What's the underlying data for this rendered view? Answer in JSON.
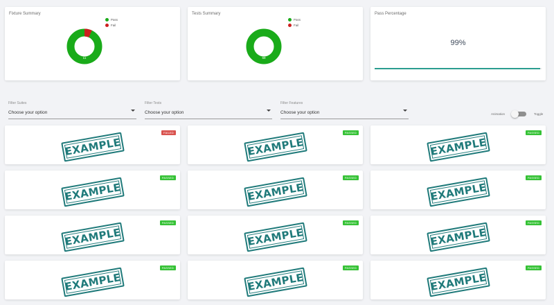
{
  "summary": {
    "fixture": {
      "title": "Fixture Summary",
      "legend": [
        {
          "label": "Pass",
          "color": "#1aab1a"
        },
        {
          "label": "Fail",
          "color": "#cc1f1f"
        }
      ],
      "center_label": "11",
      "pass_fraction": 0.93
    },
    "tests": {
      "title": "Tests Summary",
      "legend": [
        {
          "label": "Pass",
          "color": "#1aab1a"
        },
        {
          "label": "Fail",
          "color": "#cc1f1f"
        }
      ],
      "center_label": "69",
      "pass_fraction": 0.99
    },
    "pass_percentage": {
      "title": "Pass Percentage",
      "value": "99%",
      "bar_fraction": 0.99,
      "bar_color": "#2a9d8f"
    }
  },
  "filters": [
    {
      "label": "Filter Suites",
      "value": "Choose your option"
    },
    {
      "label": "Filter Tests",
      "value": "Choose your option"
    },
    {
      "label": "Filter Features",
      "value": "Choose your option"
    }
  ],
  "toggle": {
    "left_label": "Animation",
    "right_label": "Toggle"
  },
  "colors": {
    "passed": "#36c236",
    "failed": "#d9534f",
    "stamp": "#1f7a7a"
  },
  "tiles": [
    {
      "stamp": "EXAMPLE",
      "status": "FAILED"
    },
    {
      "stamp": "EXAMPLE",
      "status": "PASSED"
    },
    {
      "stamp": "EXAMPLE",
      "status": "PASSED"
    },
    {
      "stamp": "EXAMPLE",
      "status": "PASSED"
    },
    {
      "stamp": "EXAMPLE",
      "status": "PASSED"
    },
    {
      "stamp": "EXAMPLE",
      "status": "PASSED"
    },
    {
      "stamp": "EXAMPLE",
      "status": "PASSED"
    },
    {
      "stamp": "EXAMPLE",
      "status": "PASSED"
    },
    {
      "stamp": "EXAMPLE",
      "status": "PASSED"
    },
    {
      "stamp": "EXAMPLE",
      "status": "PASSED"
    },
    {
      "stamp": "EXAMPLE",
      "status": "PASSED"
    },
    {
      "stamp": "EXAMPLE",
      "status": "PASSED"
    }
  ]
}
